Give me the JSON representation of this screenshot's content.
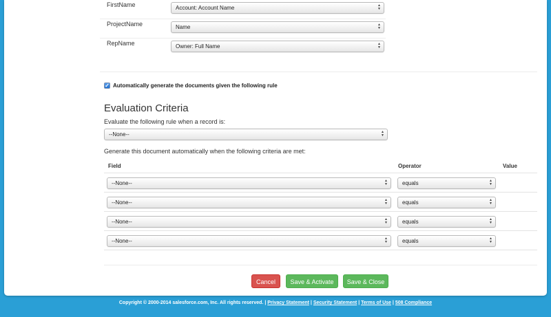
{
  "field_mappings": [
    {
      "label": "FirstName",
      "value": "Account: Account Name"
    },
    {
      "label": "ProjectName",
      "value": "Name"
    },
    {
      "label": "RepName",
      "value": "Owner: Full Name"
    }
  ],
  "auto_generate": {
    "checked": true,
    "label": "Automatically generate the documents given the following rule"
  },
  "evaluation": {
    "title": "Evaluation Criteria",
    "rule_prompt": "Evaluate the following rule when a record is:",
    "rule_value": "--None--",
    "criteria_prompt": "Generate this document automatically when the following criteria are met:"
  },
  "criteria_table": {
    "headers": {
      "field": "Field",
      "operator": "Operator",
      "value": "Value"
    },
    "rows": [
      {
        "field": "--None--",
        "operator": "equals",
        "value": ""
      },
      {
        "field": "--None--",
        "operator": "equals",
        "value": ""
      },
      {
        "field": "--None--",
        "operator": "equals",
        "value": ""
      },
      {
        "field": "--None--",
        "operator": "equals",
        "value": ""
      }
    ]
  },
  "buttons": {
    "cancel": "Cancel",
    "save_activate": "Save & Activate",
    "save_close": "Save & Close"
  },
  "footer": {
    "copyright": "Copyright © 2000-2014 salesforce.com, Inc. All rights reserved.",
    "links": [
      "Privacy Statement",
      "Security Statement",
      "Terms of Use",
      "508 Compliance"
    ]
  },
  "colors": {
    "page_background": "#2a9fd6",
    "cancel_button": "#d9534f",
    "save_button": "#5cb85c"
  }
}
